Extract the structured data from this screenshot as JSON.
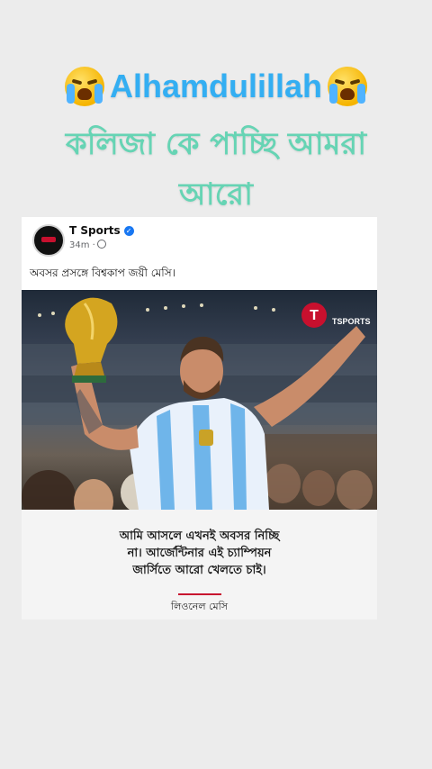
{
  "caption": {
    "line1_text": "Alhamdulillah",
    "line1_emoji": "loudly-crying-face",
    "line2": "কলিজা কে পাচ্ছি আমরা",
    "line3": "আরো"
  },
  "post": {
    "page_name": "T Sports",
    "time": "34m ·",
    "text": "অবসর প্রসঙ্গে বিশ্বকাপ জয়ী মেসি।",
    "photo_logo": "TSPORTS",
    "quote_lines": [
      "আমি আসলে এখনই অবসর নিচ্ছি",
      "না। আর্জেন্টিনার এই চ্যাম্পিয়ন",
      "জার্সিতে আরো খেলতে চাই।"
    ],
    "author": "লিওনেল মেসি"
  },
  "colors": {
    "caption_blue": "#33aef2",
    "caption_green": "#66d4b4",
    "accent_red": "#c8102e",
    "verified_blue": "#1877f2"
  }
}
